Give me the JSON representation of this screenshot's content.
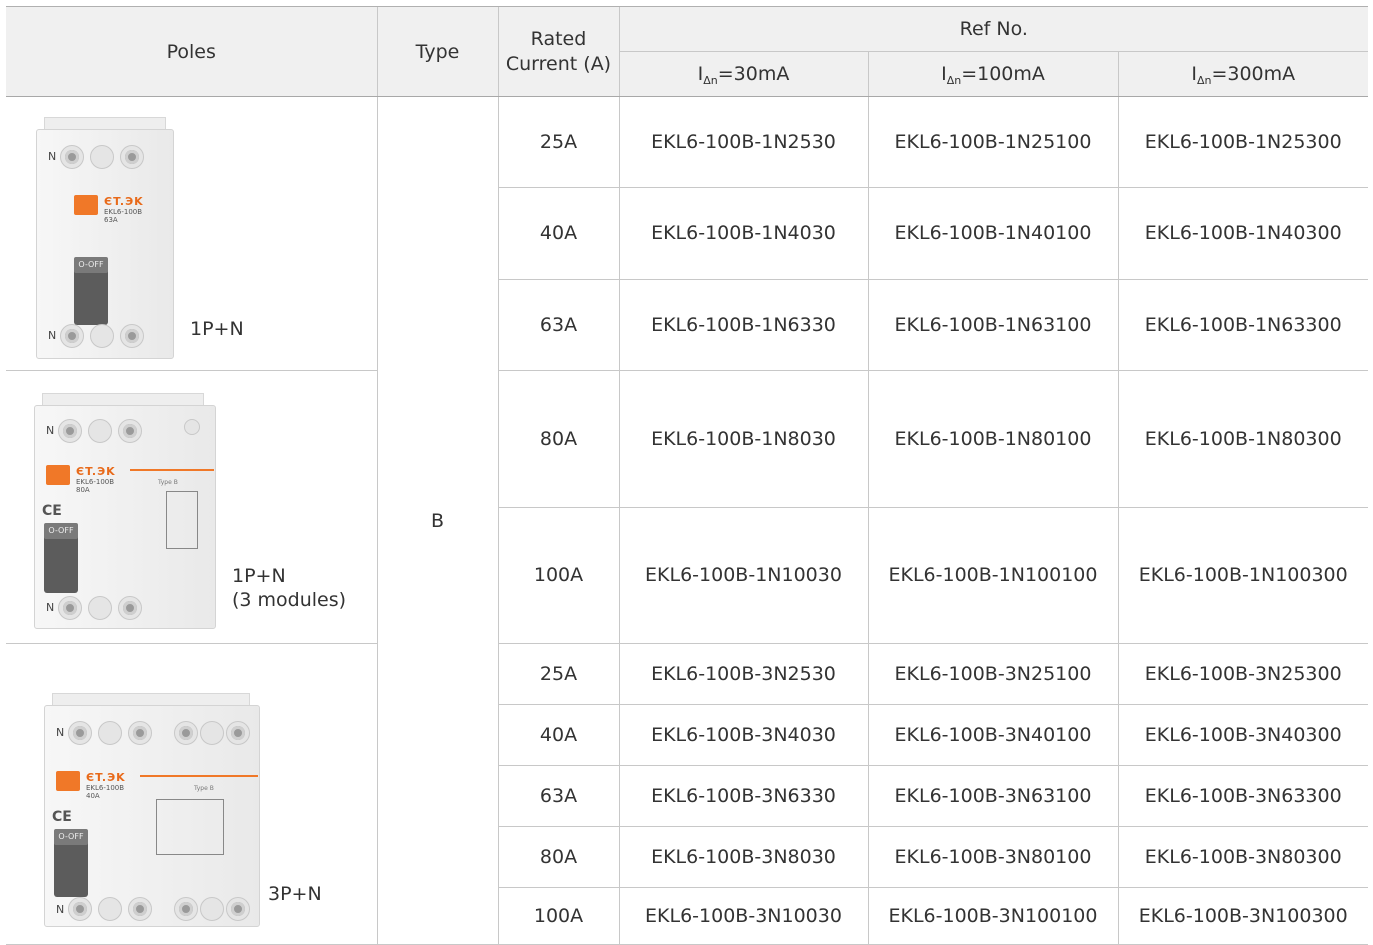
{
  "header": {
    "poles": "Poles",
    "type": "Type",
    "rated_current": "Rated Current (A)",
    "ref_no": "Ref No.",
    "sens": [
      {
        "i": "I",
        "sub": "Δn",
        "val": "=30mA"
      },
      {
        "i": "I",
        "sub": "Δn",
        "val": "=100mA"
      },
      {
        "i": "I",
        "sub": "Δn",
        "val": "=300mA"
      }
    ]
  },
  "type_value": "B",
  "groups": [
    {
      "pole_label": "1P+N",
      "pole_label_line2": "",
      "device": {
        "brand": "ЄT.ЭK",
        "model": "EKL6-100B",
        "rating": "63A",
        "lever": "O-OFF",
        "n_label": "N"
      },
      "rows": [
        {
          "current": "25A",
          "r30": "EKL6-100B-1N2530",
          "r100": "EKL6-100B-1N25100",
          "r300": "EKL6-100B-1N25300"
        },
        {
          "current": "40A",
          "r30": "EKL6-100B-1N4030",
          "r100": "EKL6-100B-1N40100",
          "r300": "EKL6-100B-1N40300"
        },
        {
          "current": "63A",
          "r30": "EKL6-100B-1N6330",
          "r100": "EKL6-100B-1N63100",
          "r300": "EKL6-100B-1N63300"
        }
      ]
    },
    {
      "pole_label": "1P+N",
      "pole_label_line2": "(3 modules)",
      "device": {
        "brand": "ЄT.ЭK",
        "model": "EKL6-100B",
        "rating": "80A",
        "lever": "O-OFF",
        "n_label": "N",
        "type_tag": "Type B"
      },
      "rows": [
        {
          "current": "80A",
          "r30": "EKL6-100B-1N8030",
          "r100": "EKL6-100B-1N80100",
          "r300": "EKL6-100B-1N80300"
        },
        {
          "current": "100A",
          "r30": "EKL6-100B-1N10030",
          "r100": "EKL6-100B-1N100100",
          "r300": "EKL6-100B-1N100300"
        }
      ]
    },
    {
      "pole_label": "3P+N",
      "pole_label_line2": "",
      "device": {
        "brand": "ЄT.ЭK",
        "model": "EKL6-100B",
        "rating": "40A",
        "lever": "O-OFF",
        "n_label": "N",
        "type_tag": "Type B"
      },
      "rows": [
        {
          "current": "25A",
          "r30": "EKL6-100B-3N2530",
          "r100": "EKL6-100B-3N25100",
          "r300": "EKL6-100B-3N25300"
        },
        {
          "current": "40A",
          "r30": "EKL6-100B-3N4030",
          "r100": "EKL6-100B-3N40100",
          "r300": "EKL6-100B-3N40300"
        },
        {
          "current": "63A",
          "r30": "EKL6-100B-3N6330",
          "r100": "EKL6-100B-3N63100",
          "r300": "EKL6-100B-3N63300"
        },
        {
          "current": "80A",
          "r30": "EKL6-100B-3N8030",
          "r100": "EKL6-100B-3N80100",
          "r300": "EKL6-100B-3N80300"
        },
        {
          "current": "100A",
          "r30": "EKL6-100B-3N10030",
          "r100": "EKL6-100B-3N100100",
          "r300": "EKL6-100B-3N100300"
        }
      ]
    }
  ],
  "colors": {
    "header_bg": "#f0f0f0",
    "border": "#c8c8c8",
    "accent": "#f07828",
    "text": "#333333"
  }
}
